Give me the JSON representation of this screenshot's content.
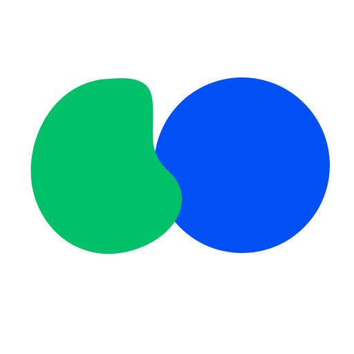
{
  "logo": {
    "icon": "two-overlapping-blobs-logo",
    "colors": {
      "background": "#ffffff",
      "green_blob": "#00c16a",
      "blue_circle": "#0050f5"
    }
  }
}
